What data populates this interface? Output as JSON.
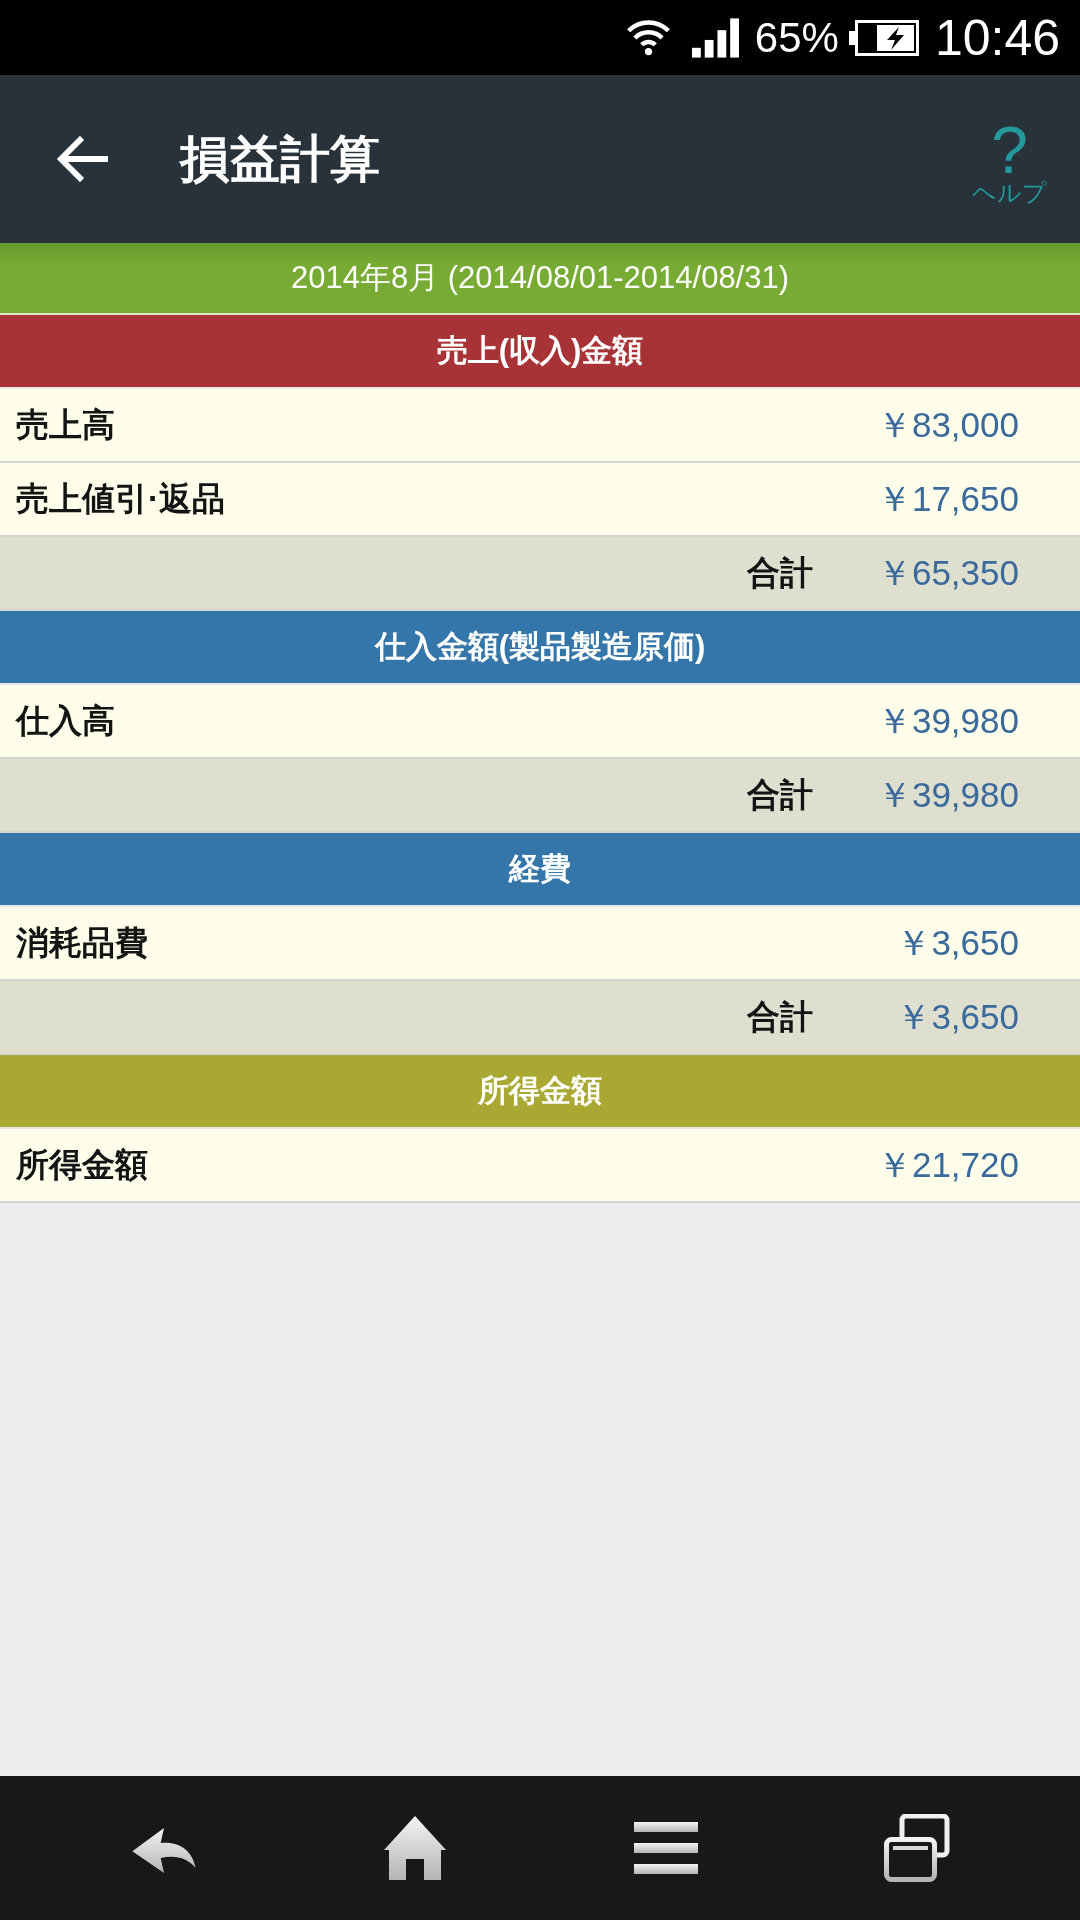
{
  "status_bar": {
    "battery": "65%",
    "time": "10:46"
  },
  "app_bar": {
    "title": "損益計算",
    "help": {
      "icon": "?",
      "label": "ヘルプ"
    }
  },
  "period": "2014年8月 (2014/08/01-2014/08/31)",
  "sections": [
    {
      "title": "売上(収入)金額",
      "color": "#a83336",
      "rows": [
        {
          "kind": "item",
          "label": "売上高",
          "amount": "￥83,000"
        },
        {
          "kind": "item",
          "label": "売上値引·返品",
          "amount": "￥17,650"
        },
        {
          "kind": "total",
          "label": "合計",
          "amount": "￥65,350"
        }
      ]
    },
    {
      "title": "仕入金額(製品製造原価)",
      "color": "#3476aa",
      "rows": [
        {
          "kind": "item",
          "label": "仕入高",
          "amount": "￥39,980"
        },
        {
          "kind": "total",
          "label": "合計",
          "amount": "￥39,980"
        }
      ]
    },
    {
      "title": "経費",
      "color": "#3476aa",
      "rows": [
        {
          "kind": "item",
          "label": "消耗品費",
          "amount": "￥3,650"
        },
        {
          "kind": "total",
          "label": "合計",
          "amount": "￥3,650"
        }
      ]
    },
    {
      "title": "所得金額",
      "color": "#a8a832",
      "rows": [
        {
          "kind": "item",
          "label": "所得金額",
          "amount": "￥21,720"
        }
      ]
    }
  ]
}
